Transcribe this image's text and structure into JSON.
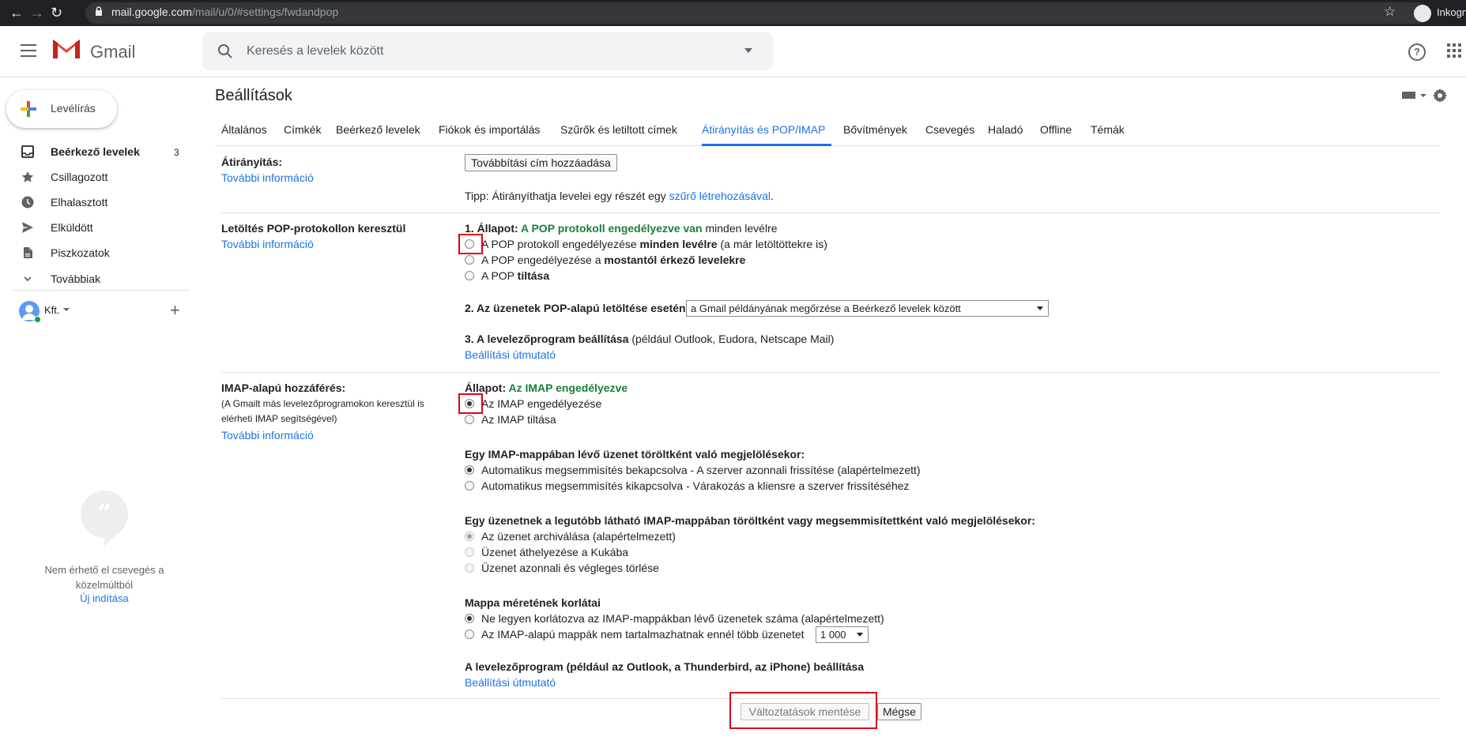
{
  "browser": {
    "url_host": "mail.google.com",
    "url_path": "/mail/u/0/#settings/fwdandpop",
    "profile_label": "Inkogn"
  },
  "header": {
    "app_name": "Gmail",
    "search_placeholder": "Keresés a levelek között"
  },
  "sidebar": {
    "compose_label": "Levélírás",
    "items": [
      {
        "label": "Beérkező levelek",
        "count": "3",
        "icon": "inbox-icon"
      },
      {
        "label": "Csillagozott",
        "icon": "star-icon"
      },
      {
        "label": "Elhalasztott",
        "icon": "clock-icon"
      },
      {
        "label": "Elküldött",
        "icon": "send-icon"
      },
      {
        "label": "Piszkozatok",
        "icon": "draft-icon"
      },
      {
        "label": "Továbbiak",
        "icon": "chevron-down-icon"
      }
    ],
    "hangouts_user": "Kft.",
    "chat_empty_text": "Nem érhető el csevegés a közelmúltból",
    "chat_start_link": "Új indítása"
  },
  "settings": {
    "title": "Beállítások",
    "tabs": [
      "Általános",
      "Címkék",
      "Beérkező levelek",
      "Fiókok és importálás",
      "Szűrők és letiltott címek",
      "Átirányítás és POP/IMAP",
      "Bővítmények",
      "Csevegés",
      "Haladó",
      "Offline",
      "Témák"
    ],
    "active_tab": "Átirányítás és POP/IMAP",
    "forwarding": {
      "label": "Átirányítás:",
      "more_info": "További információ",
      "add_button": "Továbbítási cím hozzáadása",
      "tip_prefix": "Tipp: Átirányíthatja levelei egy részét egy ",
      "tip_link": "szűrő létrehozásával",
      "tip_suffix": "."
    },
    "pop": {
      "label": "Letöltés POP-protokollon keresztül",
      "more_info": "További információ",
      "status_prefix": "1. Állapot: ",
      "status_value": "A POP protokoll engedélyezve van",
      "status_suffix": " minden levélre",
      "options": [
        {
          "pre": "A POP protokoll engedélyezése ",
          "bold": "minden levélre",
          "post": " (a már letöltöttekre is)",
          "checked": false
        },
        {
          "pre": "A POP engedélyezése a ",
          "bold": "mostantól érkező levelekre",
          "post": "",
          "checked": false
        },
        {
          "pre": "A POP ",
          "bold": "tiltása",
          "post": "",
          "checked": false
        }
      ],
      "when_label": "2. Az üzenetek POP-alapú letöltése esetén",
      "when_value": "a Gmail példányának megőrzése a Beérkező levelek között",
      "client_label": "3. A levelezőprogram beállítása",
      "client_suffix": " (például Outlook, Eudora, Netscape Mail)",
      "client_link": "Beállítási útmutató"
    },
    "imap": {
      "label": "IMAP-alapú hozzáférés:",
      "desc_line1": "(A Gmailt más levelezőprogramokon keresztül is",
      "desc_line2": "elérheti IMAP segítségével)",
      "more_info": "További információ",
      "status_prefix": "Állapot: ",
      "status_value": "Az IMAP engedélyezve",
      "options": [
        {
          "label": "Az IMAP engedélyezése",
          "checked": true
        },
        {
          "label": "Az IMAP tiltása",
          "checked": false
        }
      ],
      "deleted_label": "Egy IMAP-mappában lévő üzenet töröltként való megjelölésekor:",
      "deleted_options": [
        {
          "label": "Automatikus megsemmisítés bekapcsolva - A szerver azonnali frissítése (alapértelmezett)",
          "checked": true
        },
        {
          "label": "Automatikus megsemmisítés kikapcsolva - Várakozás a kliensre a szerver frissítéséhez",
          "checked": false
        }
      ],
      "expunge_label": "Egy üzenetnek a legutóbb látható IMAP-mappában töröltként vagy megsemmisítettként való megjelölésekor:",
      "expunge_options": [
        {
          "label": "Az üzenet archiválása (alapértelmezett)",
          "checked": true
        },
        {
          "label": "Üzenet áthelyezése a Kukába",
          "checked": false
        },
        {
          "label": "Üzenet azonnali és végleges törlése",
          "checked": false
        }
      ],
      "folder_limit_label": "Mappa méretének korlátai",
      "folder_limit_options": [
        {
          "label": "Ne legyen korlátozva az IMAP-mappákban lévő üzenetek száma (alapértelmezett)",
          "checked": true
        },
        {
          "label": "Az IMAP-alapú mappák nem tartalmazhatnak ennél több üzenetet",
          "checked": false
        }
      ],
      "folder_limit_value": "1 000",
      "client_label": "A levelezőprogram (például az Outlook, a Thunderbird, az iPhone) beállítása",
      "client_link": "Beállítási útmutató"
    },
    "save_button": "Változtatások mentése",
    "cancel_button": "Mégse"
  },
  "colors": {
    "accent": "#1a73e8",
    "status_green": "#188038",
    "highlight_red": "#e0001b"
  }
}
